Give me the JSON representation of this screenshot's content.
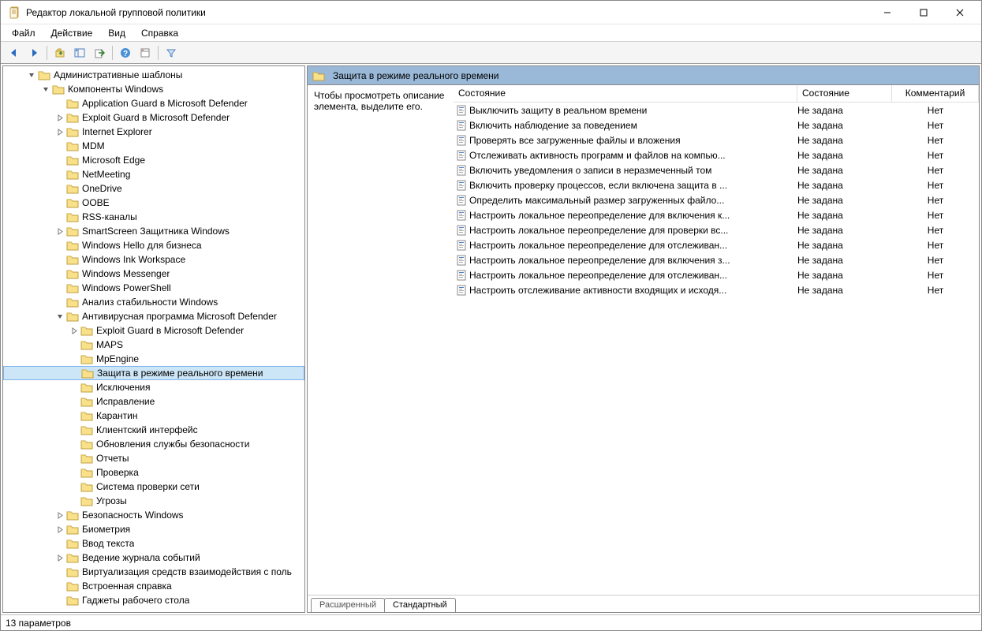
{
  "title": "Редактор локальной групповой политики",
  "menu": [
    "Файл",
    "Действие",
    "Вид",
    "Справка"
  ],
  "tree": [
    {
      "indent": 1,
      "toggle": "down",
      "label": "Административные шаблоны"
    },
    {
      "indent": 2,
      "toggle": "down",
      "label": "Компоненты Windows"
    },
    {
      "indent": 3,
      "toggle": "",
      "label": "Application Guard в Microsoft Defender"
    },
    {
      "indent": 3,
      "toggle": "right",
      "label": "Exploit Guard в Microsoft Defender"
    },
    {
      "indent": 3,
      "toggle": "right",
      "label": "Internet Explorer"
    },
    {
      "indent": 3,
      "toggle": "",
      "label": "MDM"
    },
    {
      "indent": 3,
      "toggle": "",
      "label": "Microsoft Edge"
    },
    {
      "indent": 3,
      "toggle": "",
      "label": "NetMeeting"
    },
    {
      "indent": 3,
      "toggle": "",
      "label": "OneDrive"
    },
    {
      "indent": 3,
      "toggle": "",
      "label": "OOBE"
    },
    {
      "indent": 3,
      "toggle": "",
      "label": "RSS-каналы"
    },
    {
      "indent": 3,
      "toggle": "right",
      "label": "SmartScreen Защитника Windows"
    },
    {
      "indent": 3,
      "toggle": "",
      "label": "Windows Hello для бизнеса"
    },
    {
      "indent": 3,
      "toggle": "",
      "label": "Windows Ink Workspace"
    },
    {
      "indent": 3,
      "toggle": "",
      "label": "Windows Messenger"
    },
    {
      "indent": 3,
      "toggle": "",
      "label": "Windows PowerShell"
    },
    {
      "indent": 3,
      "toggle": "",
      "label": "Анализ стабильности Windows"
    },
    {
      "indent": 3,
      "toggle": "down",
      "label": "Антивирусная программа Microsoft Defender"
    },
    {
      "indent": 4,
      "toggle": "right",
      "label": "Exploit Guard в Microsoft Defender"
    },
    {
      "indent": 4,
      "toggle": "",
      "label": "MAPS"
    },
    {
      "indent": 4,
      "toggle": "",
      "label": "MpEngine"
    },
    {
      "indent": 4,
      "toggle": "",
      "label": "Защита в режиме реального времени",
      "selected": true
    },
    {
      "indent": 4,
      "toggle": "",
      "label": "Исключения"
    },
    {
      "indent": 4,
      "toggle": "",
      "label": "Исправление"
    },
    {
      "indent": 4,
      "toggle": "",
      "label": "Карантин"
    },
    {
      "indent": 4,
      "toggle": "",
      "label": "Клиентский интерфейс"
    },
    {
      "indent": 4,
      "toggle": "",
      "label": "Обновления службы безопасности"
    },
    {
      "indent": 4,
      "toggle": "",
      "label": "Отчеты"
    },
    {
      "indent": 4,
      "toggle": "",
      "label": "Проверка"
    },
    {
      "indent": 4,
      "toggle": "",
      "label": "Система проверки сети"
    },
    {
      "indent": 4,
      "toggle": "",
      "label": "Угрозы"
    },
    {
      "indent": 3,
      "toggle": "right",
      "label": "Безопасность Windows"
    },
    {
      "indent": 3,
      "toggle": "right",
      "label": "Биометрия"
    },
    {
      "indent": 3,
      "toggle": "",
      "label": "Ввод текста"
    },
    {
      "indent": 3,
      "toggle": "right",
      "label": "Ведение журнала событий"
    },
    {
      "indent": 3,
      "toggle": "",
      "label": "Виртуализация средств взаимодействия с поль"
    },
    {
      "indent": 3,
      "toggle": "",
      "label": "Встроенная справка"
    },
    {
      "indent": 3,
      "toggle": "",
      "label": "Гаджеты рабочего стола"
    }
  ],
  "rightHeader": "Защита в режиме реального времени",
  "descHint": "Чтобы просмотреть описание элемента, выделите его.",
  "columns": {
    "name": "Состояние",
    "state": "Состояние",
    "comment": "Комментарий"
  },
  "items": [
    {
      "name": "Выключить защиту в реальном времени",
      "state": "Не задана",
      "comment": "Нет"
    },
    {
      "name": "Включить наблюдение за поведением",
      "state": "Не задана",
      "comment": "Нет"
    },
    {
      "name": "Проверять все загруженные файлы и вложения",
      "state": "Не задана",
      "comment": "Нет"
    },
    {
      "name": "Отслеживать активность программ и файлов на компью...",
      "state": "Не задана",
      "comment": "Нет"
    },
    {
      "name": "Включить уведомления о записи в неразмеченный том",
      "state": "Не задана",
      "comment": "Нет"
    },
    {
      "name": "Включить проверку процессов, если включена защита в ...",
      "state": "Не задана",
      "comment": "Нет"
    },
    {
      "name": "Определить максимальный размер загруженных файло...",
      "state": "Не задана",
      "comment": "Нет"
    },
    {
      "name": "Настроить локальное переопределение для включения к...",
      "state": "Не задана",
      "comment": "Нет"
    },
    {
      "name": "Настроить локальное переопределение для проверки вс...",
      "state": "Не задана",
      "comment": "Нет"
    },
    {
      "name": "Настроить локальное переопределение для отслеживан...",
      "state": "Не задана",
      "comment": "Нет"
    },
    {
      "name": "Настроить локальное переопределение для включения з...",
      "state": "Не задана",
      "comment": "Нет"
    },
    {
      "name": "Настроить локальное переопределение для отслеживан...",
      "state": "Не задана",
      "comment": "Нет"
    },
    {
      "name": "Настроить отслеживание активности входящих и исходя...",
      "state": "Не задана",
      "comment": "Нет"
    }
  ],
  "tabs": {
    "extended": "Расширенный",
    "standard": "Стандартный"
  },
  "status": "13 параметров"
}
